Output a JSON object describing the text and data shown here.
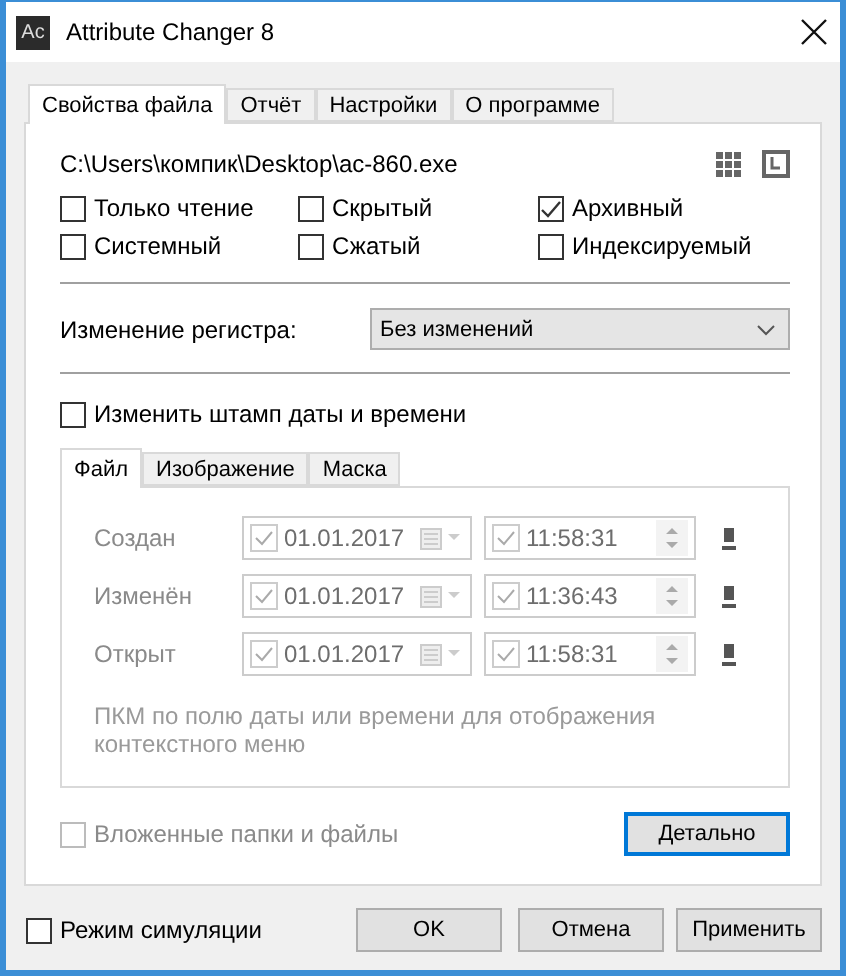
{
  "window": {
    "title": "Attribute Changer 8",
    "app_icon": "Ac"
  },
  "tabs": [
    {
      "label": "Свойства файла",
      "selected": true
    },
    {
      "label": "Отчёт",
      "selected": false
    },
    {
      "label": "Настройки",
      "selected": false
    },
    {
      "label": "О программе",
      "selected": false
    }
  ],
  "file_path": "C:\\Users\\компик\\Desktop\\ac-860.exe",
  "attributes": [
    {
      "label": "Только чтение",
      "checked": false
    },
    {
      "label": "Скрытый",
      "checked": false
    },
    {
      "label": "Архивный",
      "checked": true
    },
    {
      "label": "Системный",
      "checked": false
    },
    {
      "label": "Сжатый",
      "checked": false
    },
    {
      "label": "Индексируемый",
      "checked": false
    }
  ],
  "case_change": {
    "label": "Изменение регистра:",
    "value": "Без изменений"
  },
  "timestamp": {
    "label": "Изменить штамп даты и времени",
    "checked": false
  },
  "date_tabs": [
    {
      "label": "Файл",
      "selected": true
    },
    {
      "label": "Изображение",
      "selected": false
    },
    {
      "label": "Маска",
      "selected": false
    }
  ],
  "dates": {
    "disabled": true,
    "rows": [
      {
        "label": "Создан",
        "date": "01.01.2017",
        "date_checked": true,
        "time": "11:58:31",
        "time_checked": true
      },
      {
        "label": "Изменён",
        "date": "01.01.2017",
        "date_checked": true,
        "time": "11:36:43",
        "time_checked": true
      },
      {
        "label": "Открыт",
        "date": "01.01.2017",
        "date_checked": true,
        "time": "11:58:31",
        "time_checked": true
      }
    ],
    "note": "ПКМ по полю даты или времени для отображения контекстного меню"
  },
  "subfolders": {
    "label": "Вложенные папки и файлы",
    "checked": false,
    "disabled": true
  },
  "details_button": {
    "label": "Детально",
    "focused": true
  },
  "simulation": {
    "label": "Режим симуляции",
    "checked": false
  },
  "buttons": [
    "OK",
    "Отмена",
    "Применить"
  ]
}
